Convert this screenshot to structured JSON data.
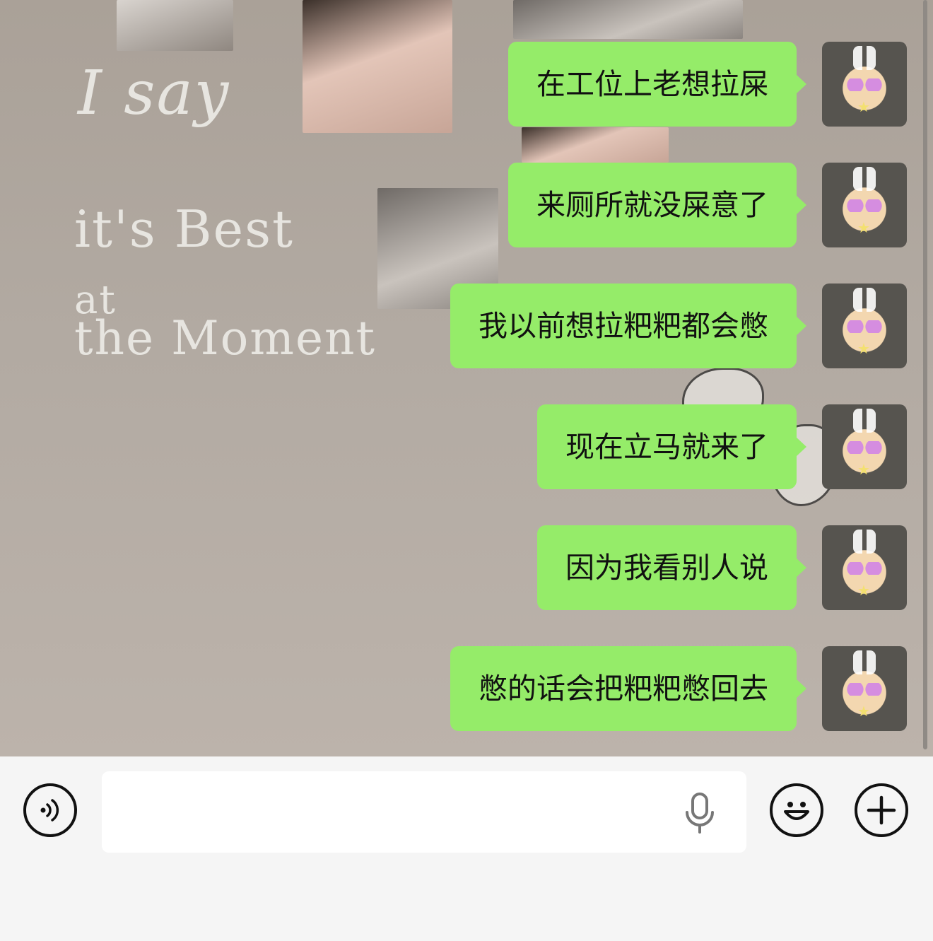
{
  "messages": [
    {
      "text": "在工位上老想拉屎"
    },
    {
      "text": "来厕所就没屎意了"
    },
    {
      "text": "我以前想拉粑粑都会憋"
    },
    {
      "text": "现在立马就来了"
    },
    {
      "text": "因为我看别人说"
    },
    {
      "text": "憋的话会把粑粑憋回去"
    }
  ],
  "background_text": {
    "line1": "I say",
    "line2": "it's Best",
    "line3": "at",
    "line4": "the Moment"
  },
  "input_bar": {
    "placeholder": "",
    "icons": {
      "voice": "voice-icon",
      "mic": "mic-icon",
      "emoji": "emoji-icon",
      "more": "plus-icon"
    }
  },
  "colors": {
    "bubble": "#95ec69",
    "chat_bg": "#b2aaa2",
    "input_bar_bg": "#f5f5f5"
  }
}
